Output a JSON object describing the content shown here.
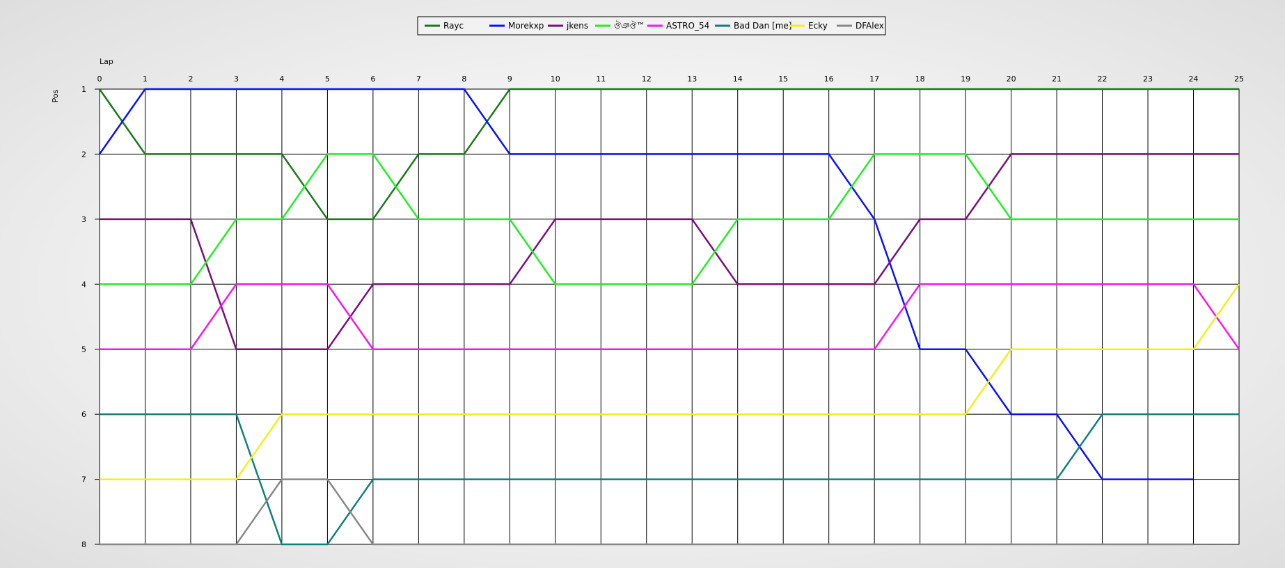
{
  "chart_data": {
    "type": "line",
    "xlabel": "Lap",
    "ylabel": "Pos",
    "x": [
      0,
      1,
      2,
      3,
      4,
      5,
      6,
      7,
      8,
      9,
      10,
      11,
      12,
      13,
      14,
      15,
      16,
      17,
      18,
      19,
      20,
      21,
      22,
      23,
      24,
      25
    ],
    "xlim": [
      0,
      25
    ],
    "ylim": [
      1,
      8
    ],
    "y_ticks": [
      1,
      2,
      3,
      4,
      5,
      6,
      7,
      8
    ],
    "y_inverted": true,
    "grid": true,
    "legend_position": "top-center",
    "series": [
      {
        "name": "Rayc",
        "color": "#1a7a1a",
        "values": [
          1,
          2,
          2,
          2,
          2,
          3,
          3,
          2,
          2,
          1,
          1,
          1,
          1,
          1,
          1,
          1,
          1,
          1,
          1,
          1,
          1,
          1,
          1,
          1,
          1,
          1
        ]
      },
      {
        "name": "Morekxp",
        "color": "#0a14f0",
        "values": [
          2,
          1,
          1,
          1,
          1,
          1,
          1,
          1,
          1,
          2,
          2,
          2,
          2,
          2,
          2,
          2,
          2,
          3,
          5,
          5,
          6,
          6,
          7,
          7,
          7,
          null
        ]
      },
      {
        "name": "jkens",
        "color": "#7a0f7a",
        "values": [
          3,
          3,
          3,
          5,
          5,
          5,
          4,
          4,
          4,
          4,
          3,
          3,
          3,
          3,
          4,
          4,
          4,
          4,
          3,
          3,
          2,
          2,
          2,
          2,
          2,
          2
        ]
      },
      {
        "name": "ঔঞঔ™",
        "color": "#22ee22",
        "values": [
          4,
          4,
          4,
          3,
          3,
          2,
          2,
          3,
          3,
          3,
          4,
          4,
          4,
          4,
          3,
          3,
          3,
          2,
          2,
          2,
          3,
          3,
          3,
          3,
          3,
          3
        ]
      },
      {
        "name": "ASTRO_54",
        "color": "#f018f0",
        "values": [
          5,
          5,
          5,
          4,
          4,
          4,
          5,
          5,
          5,
          5,
          5,
          5,
          5,
          5,
          5,
          5,
          5,
          5,
          4,
          4,
          4,
          4,
          4,
          4,
          4,
          5
        ]
      },
      {
        "name": "Bad Dan [me]",
        "color": "#0f7f7f",
        "values": [
          6,
          6,
          6,
          6,
          8,
          8,
          7,
          7,
          7,
          7,
          7,
          7,
          7,
          7,
          7,
          7,
          7,
          7,
          7,
          7,
          7,
          7,
          6,
          6,
          6,
          6
        ]
      },
      {
        "name": "Ecky",
        "color": "#f0f018",
        "values": [
          7,
          7,
          7,
          7,
          6,
          6,
          6,
          6,
          6,
          6,
          6,
          6,
          6,
          6,
          6,
          6,
          6,
          6,
          6,
          6,
          5,
          5,
          5,
          5,
          5,
          4
        ]
      },
      {
        "name": "DFAlex",
        "color": "#888888",
        "values": [
          8,
          8,
          8,
          8,
          7,
          7,
          8,
          8,
          8,
          8,
          8,
          8,
          8,
          8,
          8,
          8,
          8,
          8,
          8,
          8,
          8,
          8,
          8,
          8,
          8,
          null
        ]
      }
    ]
  }
}
